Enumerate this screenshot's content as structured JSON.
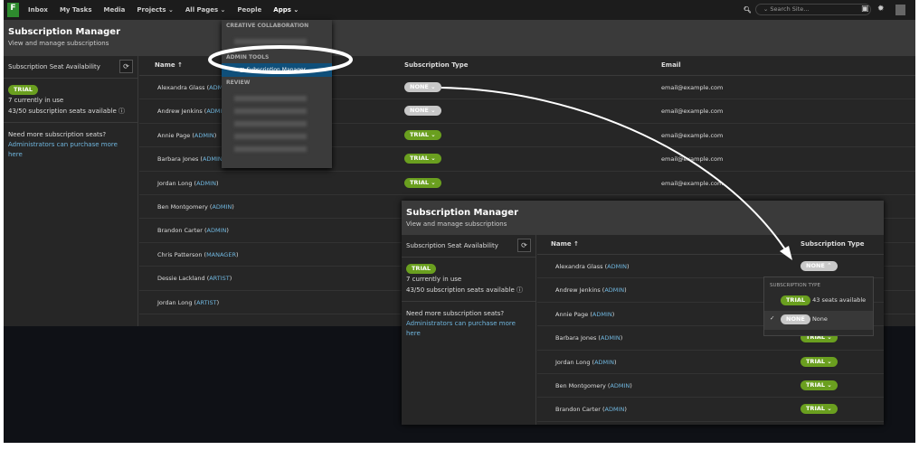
{
  "nav": {
    "logo": "F",
    "items": [
      "Inbox",
      "My Tasks",
      "Media",
      "Projects ⌄",
      "All Pages ⌄",
      "People",
      "Apps ⌄"
    ],
    "search_placeholder": "⌄ Search Site..."
  },
  "header": {
    "title": "Subscription Manager",
    "subtitle": "View and manage subscriptions"
  },
  "left": {
    "title": "Subscription Seat Availability",
    "badge": "TRIAL",
    "in_use": "7 currently in use",
    "available": "43/50 subscription seats available",
    "info": "ⓘ",
    "need": "Need more subscription seats?",
    "link": "Administrators can purchase more here"
  },
  "table": {
    "headers": [
      "Name ↑",
      "Subscription Type",
      "Email"
    ],
    "rows": [
      {
        "name": "Alexandra Glass (",
        "role": "ADMI",
        "end": "",
        "type": "NONE",
        "email": "email@example.com"
      },
      {
        "name": "Andrew Jenkins (",
        "role": "ADMI",
        "end": "",
        "type": "NONE",
        "email": "email@example.com"
      },
      {
        "name": "Annie Page (",
        "role": "ADMIN",
        "end": ")",
        "type": "TRIAL",
        "email": "email@example.com"
      },
      {
        "name": "Barbara Jones (",
        "role": "ADMIN",
        "end": "",
        "type": "TRIAL",
        "email": "email@example.com"
      },
      {
        "name": "Jordan Long (",
        "role": "ADMIN",
        "end": ")",
        "type": "TRIAL",
        "email": "email@example.com"
      },
      {
        "name": "Ben Montgomery (",
        "role": "ADMIN",
        "end": ")",
        "type": "",
        "email": ""
      },
      {
        "name": "Brandon Carter (",
        "role": "ADMIN",
        "end": ")",
        "type": "",
        "email": ""
      },
      {
        "name": "Chris Patterson (",
        "role": "MANAGER",
        "end": ")",
        "type": "",
        "email": ""
      },
      {
        "name": "Dessie Lackland (",
        "role": "ARTIST",
        "end": ")",
        "type": "",
        "email": ""
      },
      {
        "name": "Jordan Long (",
        "role": "ARTIST",
        "end": ")",
        "type": "",
        "email": ""
      }
    ]
  },
  "menu": {
    "section1": "CREATIVE COLLABORATION",
    "section2": "ADMIN TOOLS",
    "selected": "Subscription Manager",
    "section3": "REVIEW"
  },
  "inset": {
    "rows": [
      {
        "name": "Alexandra Glass (",
        "role": "ADMIN",
        "end": ")",
        "type": "NONE ⌃"
      },
      {
        "name": "Andrew Jenkins (",
        "role": "ADMIN",
        "end": ")",
        "type": ""
      },
      {
        "name": "Annie Page (",
        "role": "ADMIN",
        "end": ")",
        "type": ""
      },
      {
        "name": "Barbara Jones (",
        "role": "ADMIN",
        "end": ")",
        "type": "TRIAL ⌄"
      },
      {
        "name": "Jordan Long (",
        "role": "ADMIN",
        "end": ")",
        "type": "TRIAL ⌄"
      },
      {
        "name": "Ben Montgomery (",
        "role": "ADMIN",
        "end": ")",
        "type": "TRIAL ⌄"
      },
      {
        "name": "Brandon Carter (",
        "role": "ADMIN",
        "end": ")",
        "type": "TRIAL ⌄"
      }
    ],
    "headers": [
      "Name ↑",
      "Subscription Type"
    ]
  },
  "popup": {
    "heading": "SUBSCRIPTION TYPE",
    "opt1_badge": "TRIAL",
    "opt1_label": "43 seats available",
    "check": "✓",
    "opt2_badge": "NONE",
    "opt2_label": "None"
  }
}
